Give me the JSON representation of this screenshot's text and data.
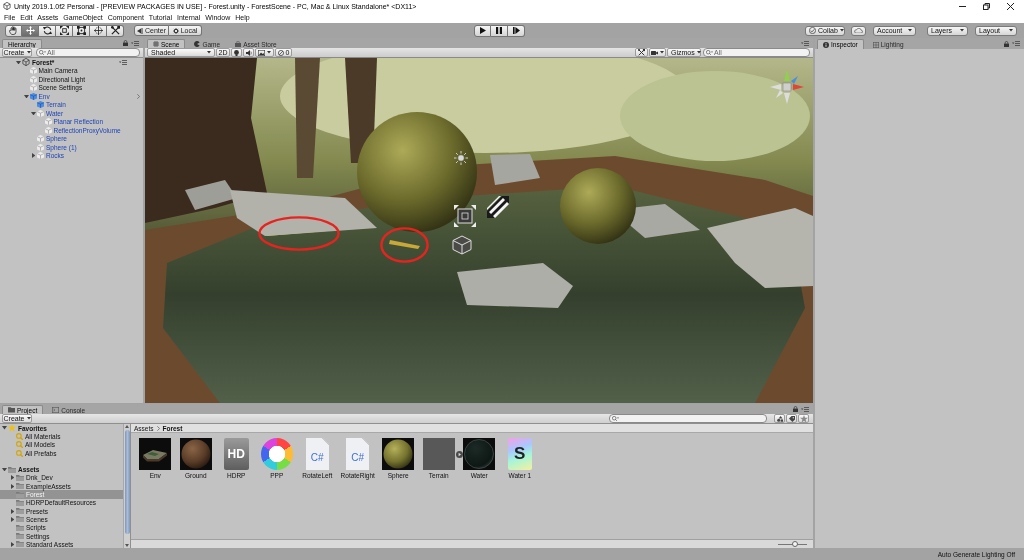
{
  "window": {
    "title": "Unity 2019.1.0f2 Personal - [PREVIEW PACKAGES IN USE] - Forest.unity - ForestScene - PC, Mac & Linux Standalone* <DX11>",
    "menu": [
      "File",
      "Edit",
      "Assets",
      "GameObject",
      "Component",
      "Tutorial",
      "Internal",
      "Window",
      "Help"
    ]
  },
  "toolbar": {
    "tools": [
      {
        "kind": "hand",
        "selected": false
      },
      {
        "kind": "move",
        "selected": true
      },
      {
        "kind": "rotate",
        "selected": false
      },
      {
        "kind": "scale",
        "selected": false
      },
      {
        "kind": "rect",
        "selected": false
      },
      {
        "kind": "transform",
        "selected": false
      },
      {
        "kind": "custom",
        "selected": false
      }
    ],
    "pivot": [
      "Center",
      "Local"
    ],
    "collab": "Collab",
    "account": "Account",
    "layers": "Layers",
    "layout": "Layout"
  },
  "hierarchy": {
    "tab": {
      "label": "Hierarchy",
      "selected": true
    },
    "create": "Create",
    "search": {
      "placeholder": "All"
    },
    "tree": [
      {
        "label": "Forest*",
        "kind": "scene",
        "expanded": true,
        "selected": false,
        "children": [
          {
            "label": "Main Camera",
            "kind": "object",
            "prefab_instance": false,
            "selected": false
          },
          {
            "label": "Directional Light",
            "kind": "object",
            "prefab_instance": false,
            "selected": false
          },
          {
            "label": "Scene Settings",
            "kind": "object",
            "prefab_instance": false,
            "selected": false
          },
          {
            "label": "Env",
            "kind": "prefab",
            "prefab_instance": true,
            "chevron": true,
            "expanded": true,
            "selected": false,
            "children": [
              {
                "label": "Terrain",
                "kind": "prefab",
                "prefab_instance": true,
                "selected": false
              },
              {
                "label": "Water",
                "kind": "object",
                "prefab_instance": true,
                "expanded": true,
                "selected": false,
                "children": [
                  {
                    "label": "Planar Reflection",
                    "kind": "object",
                    "prefab_instance": true,
                    "selected": false
                  },
                  {
                    "label": "ReflectionProxyVolume",
                    "kind": "object",
                    "prefab_instance": true,
                    "selected": false
                  }
                ]
              },
              {
                "label": "Sphere",
                "kind": "object",
                "prefab_instance": true,
                "selected": false
              },
              {
                "label": "Sphere (1)",
                "kind": "object",
                "prefab_instance": true,
                "selected": false
              },
              {
                "label": "Rocks",
                "kind": "object",
                "prefab_instance": true,
                "expanded": false,
                "selected": false
              }
            ]
          }
        ]
      }
    ]
  },
  "scene": {
    "tabs": [
      {
        "label": "Scene",
        "kind": "scene",
        "selected": true
      },
      {
        "label": "Game",
        "kind": "game",
        "selected": false
      },
      {
        "label": "Asset Store",
        "kind": "store",
        "selected": false
      }
    ],
    "toolbar": {
      "shading": "Shaded",
      "mode_2d": "2D",
      "hidden_count": "0",
      "gizmos": "Gizmos",
      "search": {
        "placeholder": "All"
      }
    }
  },
  "inspector": {
    "tabs": [
      {
        "label": "Inspector",
        "kind": "inspector",
        "selected": true
      },
      {
        "label": "Lighting",
        "kind": "lighting",
        "selected": false
      }
    ]
  },
  "project": {
    "tabs": [
      {
        "label": "Project",
        "kind": "project",
        "selected": true
      },
      {
        "label": "Console",
        "kind": "console",
        "selected": false
      }
    ],
    "create": "Create",
    "tree": [
      {
        "label": "Favorites",
        "kind": "favorites",
        "expanded": true,
        "selected": false,
        "children": [
          {
            "label": "All Materials",
            "kind": "search",
            "selected": false
          },
          {
            "label": "All Models",
            "kind": "search",
            "selected": false
          },
          {
            "label": "All Prefabs",
            "kind": "search",
            "selected": false
          }
        ]
      },
      {
        "label": "Assets",
        "kind": "folder",
        "expanded": true,
        "selected": false,
        "children": [
          {
            "label": "Dnk_Dev",
            "kind": "folder",
            "expanded": false,
            "selected": false
          },
          {
            "label": "ExampleAssets",
            "kind": "folder",
            "expanded": false,
            "selected": false
          },
          {
            "label": "Forest",
            "kind": "folder",
            "selected": true
          },
          {
            "label": "HDRPDefaultResources",
            "kind": "folder",
            "selected": false
          },
          {
            "label": "Presets",
            "kind": "folder",
            "expanded": false,
            "selected": false
          },
          {
            "label": "Scenes",
            "kind": "folder",
            "expanded": false,
            "selected": false
          },
          {
            "label": "Scripts",
            "kind": "folder",
            "selected": false
          },
          {
            "label": "Settings",
            "kind": "folder",
            "selected": false
          },
          {
            "label": "Standard Assets",
            "kind": "folder",
            "expanded": false,
            "selected": false
          }
        ]
      }
    ],
    "breadcrumb": [
      "Assets",
      "Forest"
    ],
    "assets": [
      {
        "name": "Env",
        "kind": "model",
        "selected": false
      },
      {
        "name": "Ground",
        "kind": "dirt",
        "selected": false
      },
      {
        "name": "HDRP",
        "kind": "hdrp",
        "thumb_text": "HD",
        "selected": false
      },
      {
        "name": "PPP",
        "kind": "profile",
        "selected": false
      },
      {
        "name": "RotateLeft",
        "kind": "script",
        "thumb_text": "C#",
        "selected": false
      },
      {
        "name": "RotateRight",
        "kind": "script",
        "thumb_text": "C#",
        "selected": false
      },
      {
        "name": "Sphere",
        "kind": "moss",
        "selected": false
      },
      {
        "name": "Terrain",
        "kind": "terrain",
        "selected": false
      },
      {
        "name": "Water",
        "kind": "water",
        "selected": false
      },
      {
        "name": "Water 1",
        "kind": "shader",
        "thumb_text": "S",
        "selected": false
      }
    ],
    "thumbnail_slider": {
      "level": 0.6
    }
  },
  "status_bar": "Auto Generate Lighting Off"
}
